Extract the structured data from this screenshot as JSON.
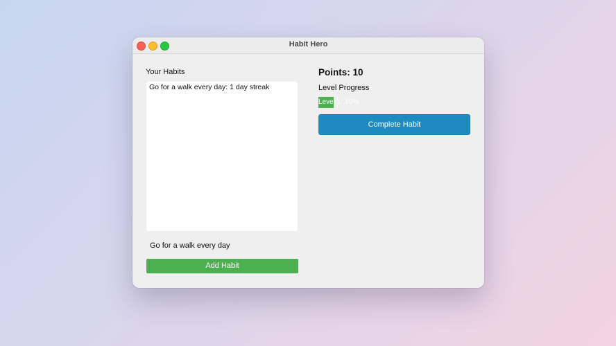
{
  "window": {
    "title": "Habit Hero"
  },
  "habits": {
    "label": "Your Habits",
    "items": [
      {
        "text": "Go for a walk every day: 1 day streak"
      }
    ],
    "input_value": "Go for a walk every day",
    "add_button_label": "Add Habit"
  },
  "stats": {
    "points_text": "Points: 10",
    "level_progress_label": "Level Progress",
    "progress_bar_text": "Level 1: 10%",
    "progress_fraction": 0.1,
    "complete_button_label": "Complete Habit"
  },
  "colors": {
    "add_button": "#4caf50",
    "progress_fill": "#4caf50",
    "complete_button": "#1d8bc0"
  }
}
